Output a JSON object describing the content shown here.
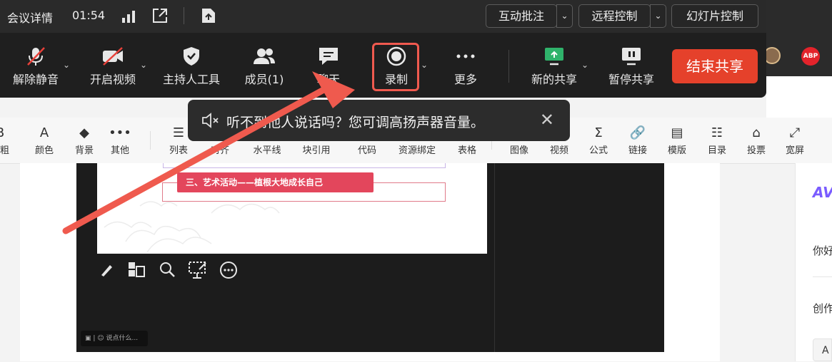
{
  "meeting": {
    "info_label": "会议详情",
    "elapsed_time": "01:54",
    "top_buttons": {
      "annotate": "互动批注",
      "remote_control": "远程控制",
      "slide_control": "幻灯片控制"
    },
    "controls": {
      "unmute": "解除静音",
      "start_video": "开启视频",
      "host_tools": "主持人工具",
      "members": "成员(1)",
      "chat": "聊天",
      "record": "录制",
      "more": "更多",
      "new_share": "新的共享",
      "pause_share": "暂停共享",
      "end_share": "结束共享"
    },
    "toast": {
      "text": "听不到他人说话吗？您可调高扬声器音量。"
    }
  },
  "editor": {
    "toolbar": [
      {
        "icon": "bold-icon",
        "glyph": "B",
        "label": "加粗"
      },
      {
        "icon": "text-color-icon",
        "glyph": "A",
        "label": "颜色"
      },
      {
        "icon": "fill-icon",
        "glyph": "◆",
        "label": "背景"
      },
      {
        "icon": "more-dots-icon",
        "glyph": "•••",
        "label": "其他"
      },
      {
        "icon": "list-icon",
        "glyph": "☰",
        "label": "列表"
      },
      {
        "icon": "align-icon",
        "glyph": "≡",
        "label": "对齐"
      },
      {
        "icon": "horizontal-line-icon",
        "glyph": "—",
        "label": "水平线"
      },
      {
        "icon": "quote-icon",
        "glyph": "❝",
        "label": "块引用"
      },
      {
        "icon": "code-icon",
        "glyph": "</>",
        "label": "代码"
      },
      {
        "icon": "binding-icon",
        "glyph": "⛓",
        "label": "资源绑定"
      },
      {
        "icon": "table-icon",
        "glyph": "▦",
        "label": "表格"
      },
      {
        "icon": "image-icon",
        "glyph": "▣",
        "label": "图像"
      },
      {
        "icon": "video-icon",
        "glyph": "▶",
        "label": "视频"
      },
      {
        "icon": "formula-icon",
        "glyph": "Σ",
        "label": "公式"
      },
      {
        "icon": "link-icon",
        "glyph": "🔗",
        "label": "链接"
      },
      {
        "icon": "template-icon",
        "glyph": "▤",
        "label": "模版"
      },
      {
        "icon": "toc-icon",
        "glyph": "☷",
        "label": "目录"
      },
      {
        "icon": "vote-icon",
        "glyph": "⌂",
        "label": "投票"
      },
      {
        "icon": "wide-screen-icon",
        "glyph": "⤢",
        "label": "宽屏"
      }
    ],
    "right_panel": {
      "logo_text": "AV",
      "greeting": "你好",
      "create": "创作",
      "input": "A"
    }
  },
  "shared_slide": {
    "banner": "三、艺术活动——植根大地成长自己",
    "chat_placeholder": "说点什么..."
  },
  "colors": {
    "meeting_bg": "#1f1f1f",
    "end_share": "#e5412b",
    "record_highlight": "#f05a4f",
    "arrow": "#ef5a4e",
    "slide_banner": "#e3465c"
  }
}
